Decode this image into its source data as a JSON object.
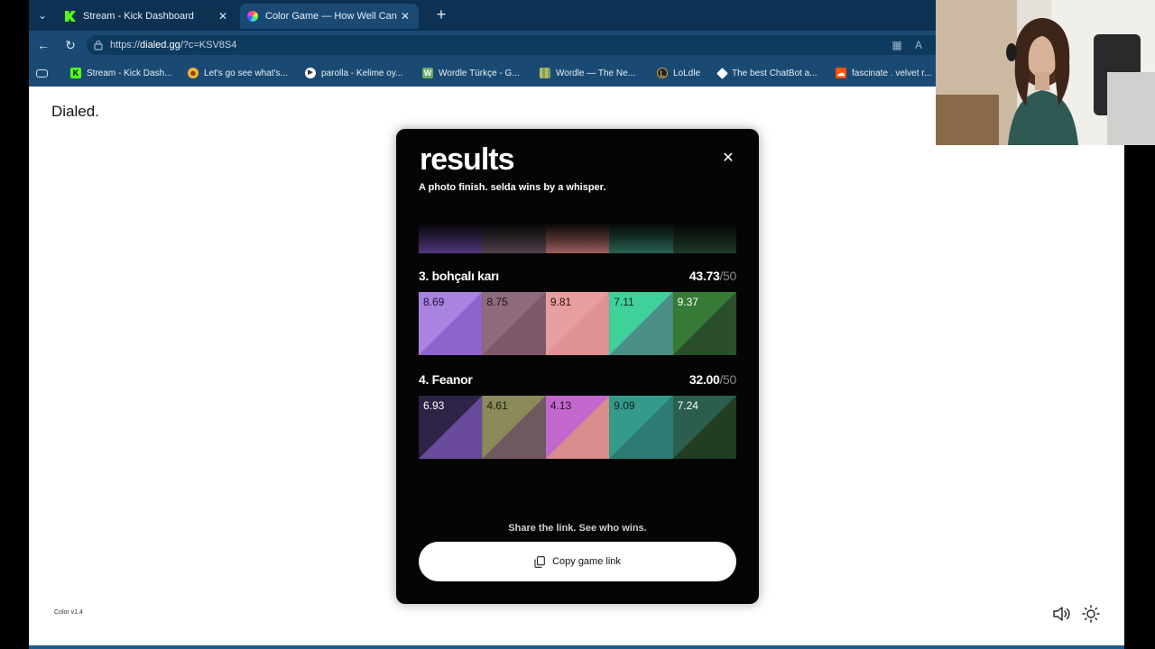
{
  "browser": {
    "tabs": [
      {
        "title": "Stream - Kick Dashboard",
        "active": false
      },
      {
        "title": "Color Game — How Well Can You",
        "active": true
      }
    ],
    "url_prefix": "https://",
    "url_domain": "dialed.gg",
    "url_path": "/?c=KSV8S4",
    "bookmarks": [
      {
        "label": "Stream - Kick Dash...",
        "icon": "kick-icon",
        "color": "#53fc18"
      },
      {
        "label": "Let's go see what's...",
        "icon": "emoji-icon",
        "color": "#f2b233"
      },
      {
        "label": "parolla - Kelime oy...",
        "icon": "play-circle-icon",
        "color": "#ffffff"
      },
      {
        "label": "Wordle Türkçe - G...",
        "icon": "wordle-w-icon",
        "color": "#6aaa64"
      },
      {
        "label": "Wordle — The Ne...",
        "icon": "grid-icon",
        "color": "#c9b458"
      },
      {
        "label": "LoLdle",
        "icon": "loldle-icon",
        "color": "#222222"
      },
      {
        "label": "The best ChatBot a...",
        "icon": "chatbot-icon",
        "color": "#ffffff"
      },
      {
        "label": "fascinate . velvet r...",
        "icon": "soundcloud-icon",
        "color": "#ff5500"
      }
    ]
  },
  "page": {
    "logo": "Dialed.",
    "version": "Color v1.4"
  },
  "modal": {
    "title": "results",
    "subtitle": "A photo finish. selda wins by a whisper.",
    "faded_colors": [
      "#5b3b8c",
      "#5a4a55",
      "#b06868",
      "#2e6e5e",
      "#23402a"
    ],
    "players": [
      {
        "name": "3. bohçalı karı",
        "score": "43.73",
        "max": "/50",
        "swatches": [
          {
            "value": "8.69",
            "target": "#8e63cc",
            "guess": "#a884e0",
            "text_color": "#1a1030"
          },
          {
            "value": "8.75",
            "target": "#7c5a6c",
            "guess": "#8e6a7c",
            "text_color": "#1c1118"
          },
          {
            "value": "9.81",
            "target": "#e09292",
            "guess": "#e69e9e",
            "text_color": "#2a1010"
          },
          {
            "value": "7.11",
            "target": "#4a8e86",
            "guess": "#40d09a",
            "text_color": "#0b2a20"
          },
          {
            "value": "9.37",
            "target": "#2a4f2a",
            "guess": "#357a35",
            "text_color": "#ffffff"
          }
        ]
      },
      {
        "name": "4. Feanor",
        "score": "32.00",
        "max": "/50",
        "swatches": [
          {
            "value": "6.93",
            "target": "#6a4a9a",
            "guess": "#2c2346",
            "text_color": "#ffffff"
          },
          {
            "value": "4.61",
            "target": "#6e5a5e",
            "guess": "#8a8a5a",
            "text_color": "#1a1a0a"
          },
          {
            "value": "4.13",
            "target": "#d98e8e",
            "guess": "#c268cc",
            "text_color": "#2a0f2a"
          },
          {
            "value": "9.09",
            "target": "#2e7a74",
            "guess": "#349a8a",
            "text_color": "#0a2522"
          },
          {
            "value": "7.24",
            "target": "#223d22",
            "guess": "#2b5e4e",
            "text_color": "#ffffff"
          }
        ]
      }
    ],
    "share_text": "Share the link. See who wins.",
    "copy_button": "Copy game link"
  }
}
